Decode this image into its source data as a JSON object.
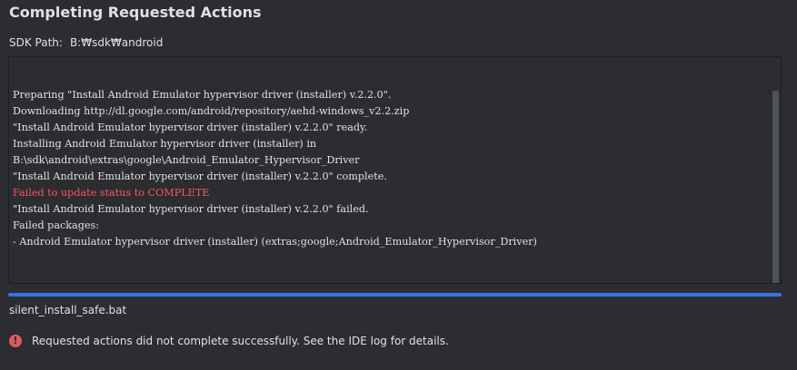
{
  "dialog": {
    "title": "Completing Requested Actions",
    "sdk_path_label": "SDK Path:",
    "sdk_path_value": "B:₩sdk₩android"
  },
  "log": {
    "lines": [
      {
        "text": "Preparing \"Install Android Emulator hypervisor driver (installer) v.2.2.0\".",
        "type": "normal"
      },
      {
        "text": "Downloading http://dl.google.com/android/repository/aehd-windows_v2.2.zip",
        "type": "normal"
      },
      {
        "text": "\"Install Android Emulator hypervisor driver (installer) v.2.2.0\" ready.",
        "type": "normal"
      },
      {
        "text": "Installing Android Emulator hypervisor driver (installer) in",
        "type": "normal"
      },
      {
        "text": "B:\\sdk\\android\\extras\\google\\Android_Emulator_Hypervisor_Driver",
        "type": "normal"
      },
      {
        "text": "\"Install Android Emulator hypervisor driver (installer) v.2.2.0\" complete.",
        "type": "normal"
      },
      {
        "text": "Failed to update status to COMPLETE",
        "type": "error"
      },
      {
        "text": "\"Install Android Emulator hypervisor driver (installer) v.2.2.0\" failed.",
        "type": "normal"
      },
      {
        "text": "Failed packages:",
        "type": "normal"
      },
      {
        "text": "- Android Emulator hypervisor driver (installer) (extras;google;Android_Emulator_Hypervisor_Driver)",
        "type": "normal"
      }
    ]
  },
  "progress": {
    "fraction": 1.0
  },
  "current_file": "silent_install_safe.bat",
  "status": {
    "icon": "error-icon",
    "icon_glyph": "!",
    "message": "Requested actions did not complete successfully. See the IDE log for details."
  },
  "colors": {
    "background": "#2b2d30",
    "text": "#dfe1e5",
    "error_text": "#f75464",
    "progress": "#3574f0",
    "error_icon": "#db5c5c"
  }
}
